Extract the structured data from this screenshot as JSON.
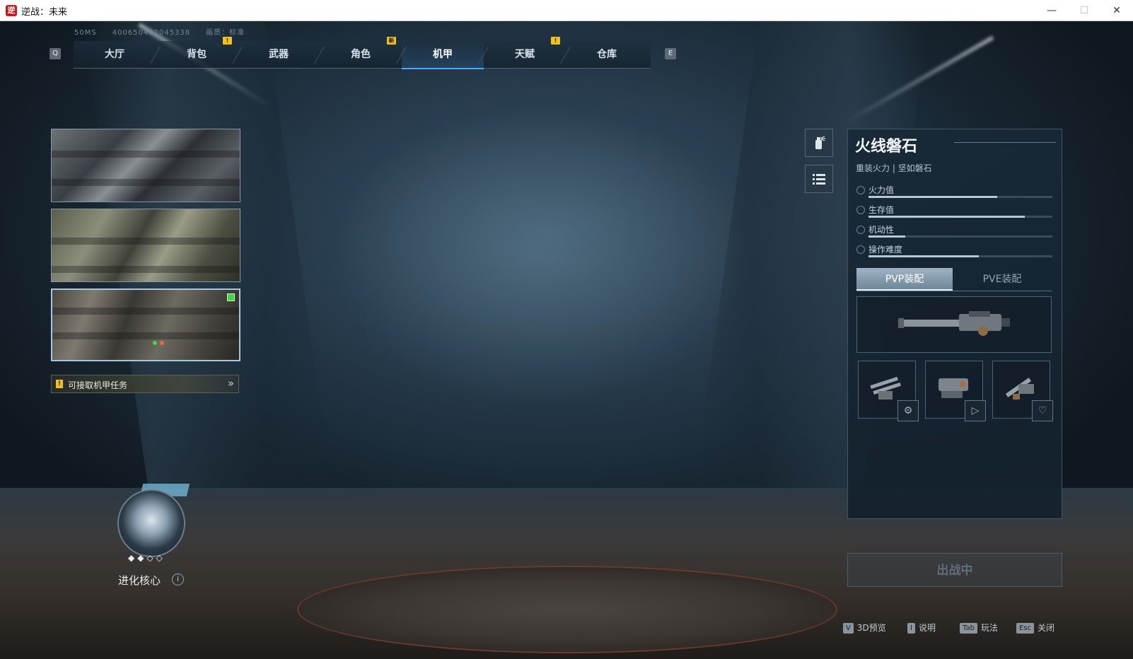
{
  "window": {
    "title": "逆战：未来",
    "min_glyph": "—",
    "max_glyph": "☐",
    "close_glyph": "✕"
  },
  "hud": {
    "ping": "50MS",
    "id": "400650462045338",
    "quality": "画质：标准"
  },
  "nav": {
    "left_key": "Q",
    "right_key": "E",
    "tabs": [
      {
        "label": "大厅",
        "badge": ""
      },
      {
        "label": "背包",
        "badge": "!"
      },
      {
        "label": "武器",
        "badge": ""
      },
      {
        "label": "角色",
        "badge": "新"
      },
      {
        "label": "机甲",
        "badge": ""
      },
      {
        "label": "天赋",
        "badge": "!"
      },
      {
        "label": "仓库",
        "badge": ""
      }
    ],
    "active_tab": "机甲"
  },
  "mech_list": {
    "selected_index": 2
  },
  "task": {
    "warn": "!",
    "label": "可接取机甲任务",
    "arrow": "»"
  },
  "core": {
    "dots": "◆◆◇◇",
    "label": "进化核心",
    "info": "i"
  },
  "mech": {
    "name": "火线磐石",
    "subtitle": "重装火力 | 坚如磐石",
    "stats": [
      {
        "label": "火力值",
        "value": 0.7
      },
      {
        "label": "生存值",
        "value": 0.85
      },
      {
        "label": "机动性",
        "value": 0.2
      },
      {
        "label": "操作难度",
        "value": 0.6
      }
    ]
  },
  "loadout": {
    "tabs": [
      "PVP装配",
      "PVE装配"
    ],
    "active": "PVP装配"
  },
  "deploy_label": "出战中",
  "hints": [
    {
      "key": "V",
      "label": "3D预览"
    },
    {
      "key": "I",
      "label": "说明"
    },
    {
      "key": "Tab",
      "label": "玩法"
    },
    {
      "key": "Esc",
      "label": "关闭"
    }
  ],
  "colors": {
    "accent": "#4aa9ff",
    "badge": "#f3c21a",
    "selected": "#46d24b"
  }
}
